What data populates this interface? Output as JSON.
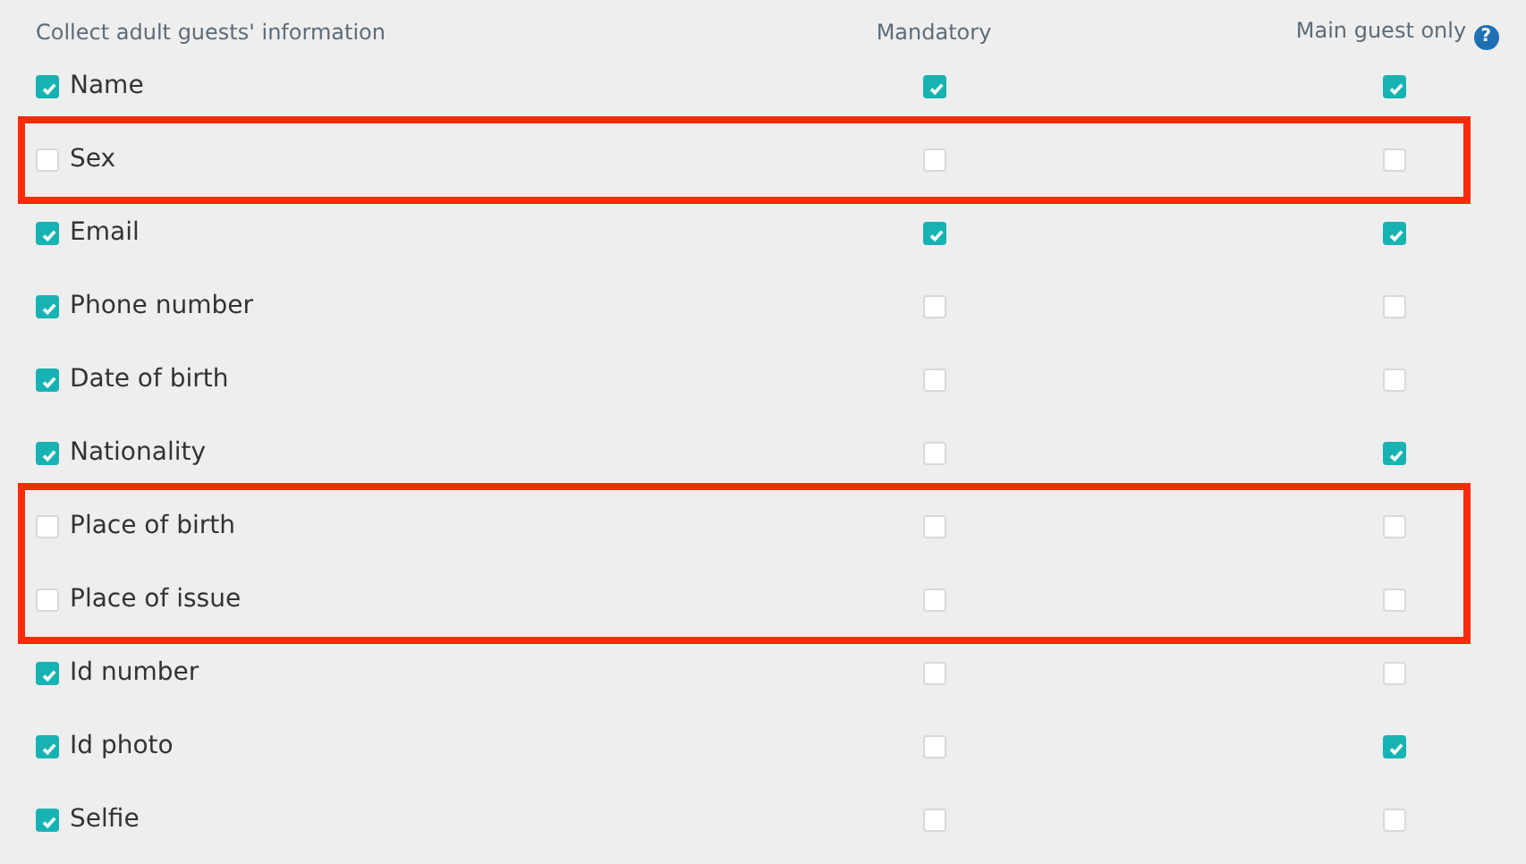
{
  "header": {
    "column_1": "Collect adult guests' information",
    "column_2": "Mandatory",
    "column_3": "Main guest only",
    "help_icon": "?"
  },
  "groups": [
    {
      "highlighted": false,
      "rows": [
        {
          "label": "Name",
          "checked": true,
          "mandatory": true,
          "main_guest_only": true
        }
      ]
    },
    {
      "highlighted": true,
      "rows": [
        {
          "label": "Sex",
          "checked": false,
          "mandatory": false,
          "main_guest_only": false
        }
      ]
    },
    {
      "highlighted": false,
      "rows": [
        {
          "label": "Email",
          "checked": true,
          "mandatory": true,
          "main_guest_only": true
        },
        {
          "label": "Phone number",
          "checked": true,
          "mandatory": false,
          "main_guest_only": false
        },
        {
          "label": "Date of birth",
          "checked": true,
          "mandatory": false,
          "main_guest_only": false
        },
        {
          "label": "Nationality",
          "checked": true,
          "mandatory": false,
          "main_guest_only": true
        }
      ]
    },
    {
      "highlighted": true,
      "rows": [
        {
          "label": "Place of birth",
          "checked": false,
          "mandatory": false,
          "main_guest_only": false
        },
        {
          "label": "Place of issue",
          "checked": false,
          "mandatory": false,
          "main_guest_only": false
        }
      ]
    },
    {
      "highlighted": false,
      "rows": [
        {
          "label": "Id number",
          "checked": true,
          "mandatory": false,
          "main_guest_only": false
        },
        {
          "label": "Id photo",
          "checked": true,
          "mandatory": false,
          "main_guest_only": true
        },
        {
          "label": "Selfie",
          "checked": true,
          "mandatory": false,
          "main_guest_only": false
        }
      ]
    }
  ]
}
